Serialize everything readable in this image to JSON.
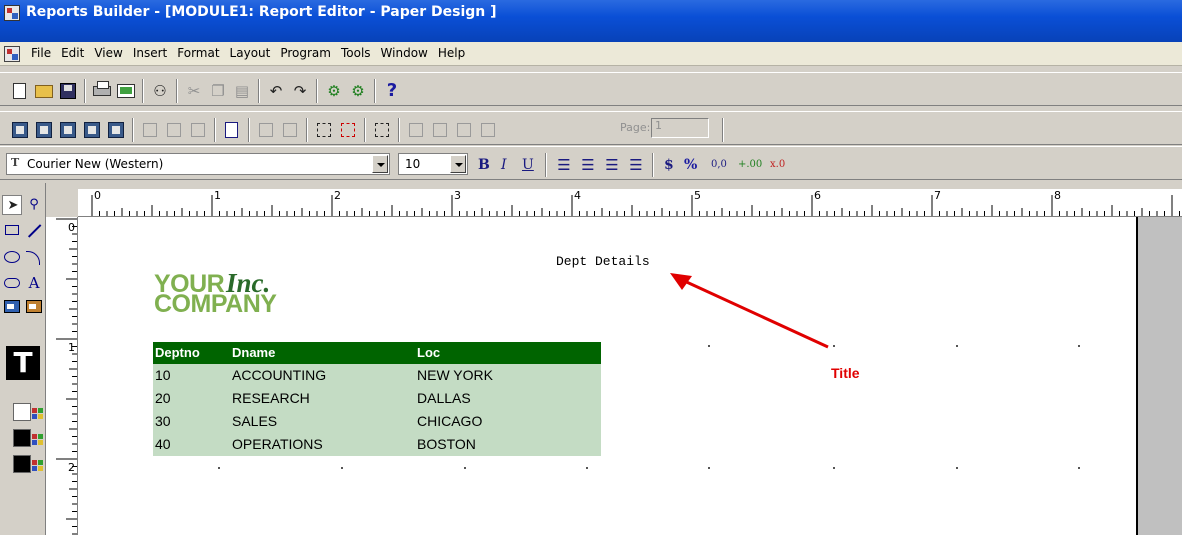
{
  "window": {
    "title": "Reports Builder - [MODULE1: Report Editor - Paper Design ]"
  },
  "menu": [
    "File",
    "Edit",
    "View",
    "Insert",
    "Format",
    "Layout",
    "Program",
    "Tools",
    "Window",
    "Help"
  ],
  "toolbar_icons": {
    "row1": [
      "new-document-icon",
      "open-folder-icon",
      "save-disk-icon",
      "print-icon",
      "mail-icon",
      "connect-icon",
      "cut-icon",
      "copy-icon",
      "paste-icon",
      "undo-icon",
      "redo-icon",
      "run-report-icon",
      "run-preview-icon",
      "help-icon"
    ],
    "row2": [
      "data-model-icon",
      "web-source-icon",
      "paper-layout-icon",
      "paper-design-icon",
      "parameter-form-icon",
      "align-icon",
      "page-icon",
      "frame-icon",
      "select-parent-icon",
      "first-page-icon",
      "prev-page-icon",
      "next-page-icon",
      "last-page-icon"
    ]
  },
  "pager": {
    "label": "Page:",
    "value": "1"
  },
  "format_bar": {
    "font_prefix": "T",
    "font": "Courier New (Western)",
    "size": "10",
    "bold": "B",
    "italic": "I",
    "underline": "U",
    "currency": "$",
    "percent": "%",
    "comma": "0,0",
    "add_decimal": "+.00",
    "remove_decimal": "x.0"
  },
  "palette": {
    "text_tool": "T",
    "text_glyph": "A"
  },
  "ruler": {
    "horizontal": [
      "0",
      "1",
      "2",
      "3",
      "4",
      "5",
      "6",
      "7",
      "8"
    ],
    "vertical": [
      "0",
      "1",
      "2"
    ]
  },
  "report": {
    "title": "Dept Details",
    "logo": {
      "line1": "YOUR",
      "inc": "Inc.",
      "line2": "COMPANY"
    },
    "columns": [
      "Deptno",
      "Dname",
      "Loc"
    ],
    "rows": [
      [
        "10",
        "ACCOUNTING",
        "NEW YORK"
      ],
      [
        "20",
        "RESEARCH",
        "DALLAS"
      ],
      [
        "30",
        "SALES",
        "CHICAGO"
      ],
      [
        "40",
        "OPERATIONS",
        "BOSTON"
      ]
    ]
  },
  "annotation": {
    "label": "Title",
    "color": "#e00000"
  },
  "colors": {
    "titlebar": "#0a4fd6",
    "table_header": "#006400",
    "table_body": "#c4dcc4",
    "logo_light": "#80b050",
    "logo_dark": "#2a6a2a"
  }
}
